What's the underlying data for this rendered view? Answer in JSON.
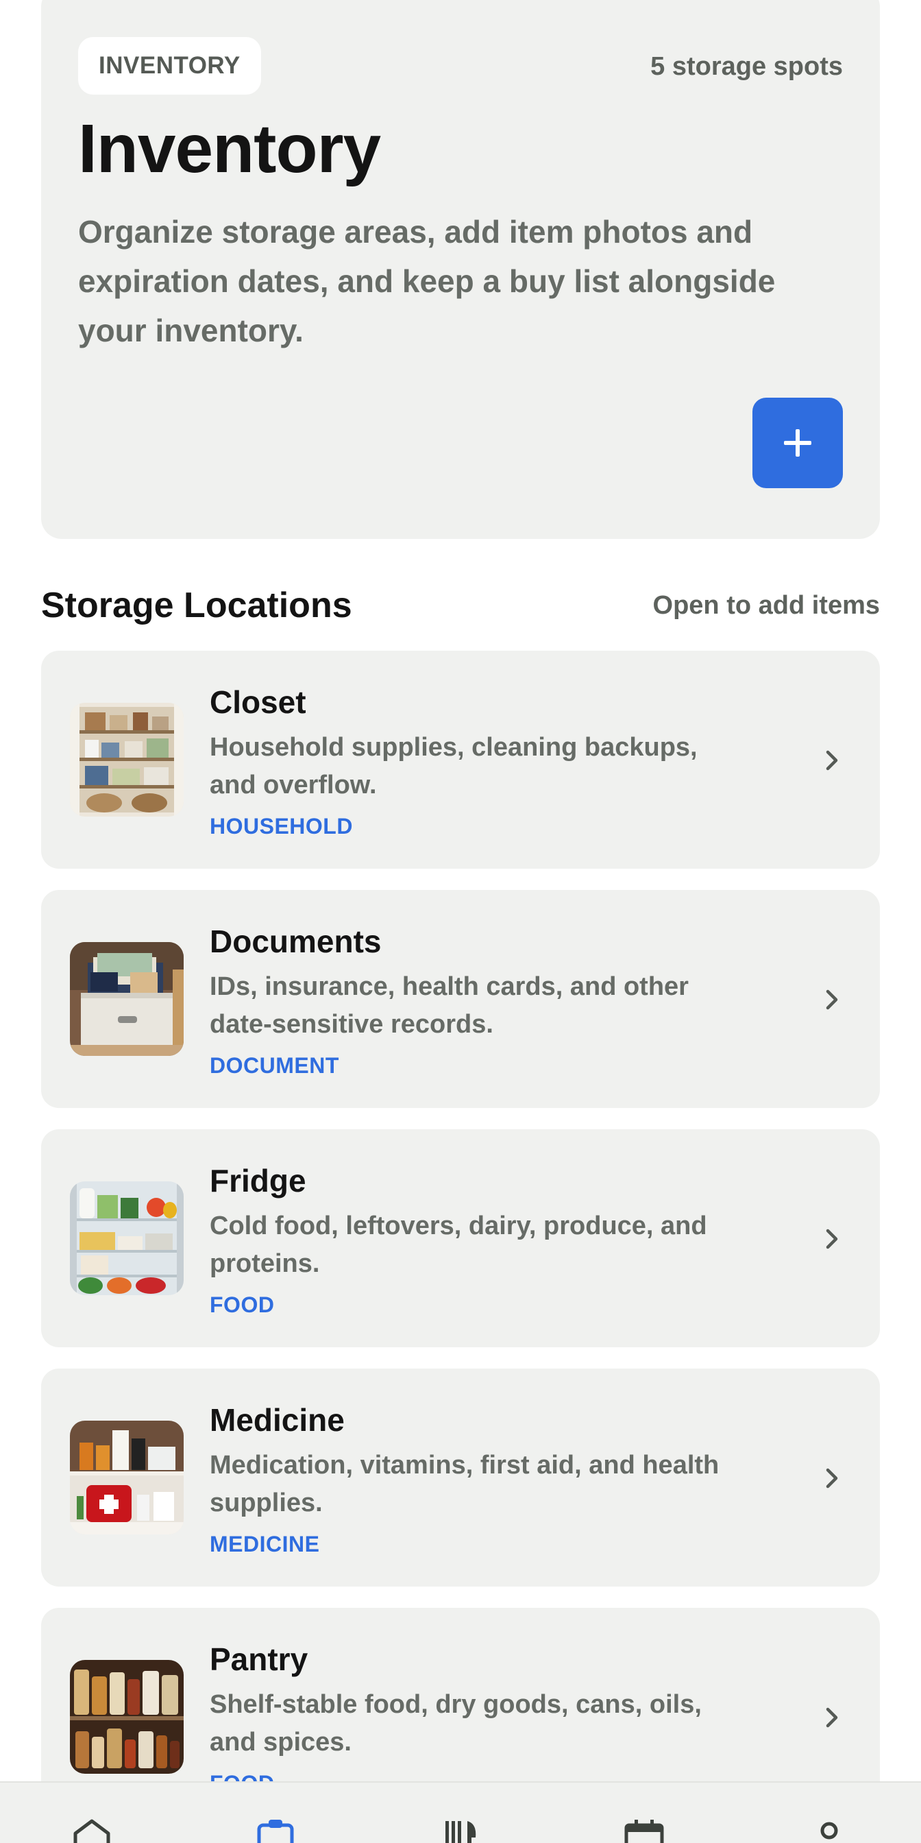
{
  "hero": {
    "chip_label": "INVENTORY",
    "storage_count": "5 storage spots",
    "title": "Inventory",
    "description": "Organize storage areas, add item photos and expiration dates, and keep a buy list alongside your inventory.",
    "add_button_icon": "plus-icon"
  },
  "section": {
    "title": "Storage Locations",
    "hint": "Open to add items"
  },
  "locations": [
    {
      "name": "Closet",
      "description": "Household supplies, cleaning backups, and overflow.",
      "tag": "HOUSEHOLD",
      "thumb": "closet-shelves-photo"
    },
    {
      "name": "Documents",
      "description": "IDs, insurance, health cards, and other date-sensitive records.",
      "tag": "DOCUMENT",
      "thumb": "document-box-photo"
    },
    {
      "name": "Fridge",
      "description": "Cold food, leftovers, dairy, produce, and proteins.",
      "tag": "FOOD",
      "thumb": "fridge-interior-photo"
    },
    {
      "name": "Medicine",
      "description": "Medication, vitamins, first aid, and health supplies.",
      "tag": "MEDICINE",
      "thumb": "medicine-cabinet-photo"
    },
    {
      "name": "Pantry",
      "description": "Shelf-stable food, dry goods, cans, oils, and spices.",
      "tag": "FOOD",
      "thumb": "pantry-jars-photo"
    }
  ],
  "nav": {
    "items": [
      "home-icon",
      "inventory-clipboard-icon",
      "meals-fork-icon",
      "calendar-icon",
      "profile-icon"
    ],
    "active": "inventory-clipboard-icon",
    "accent_color": "#2f6ddf"
  },
  "colors": {
    "accent": "#2f6ddf",
    "card_bg": "#f0f1ef",
    "text_primary": "#141414",
    "text_secondary": "#666b66"
  }
}
